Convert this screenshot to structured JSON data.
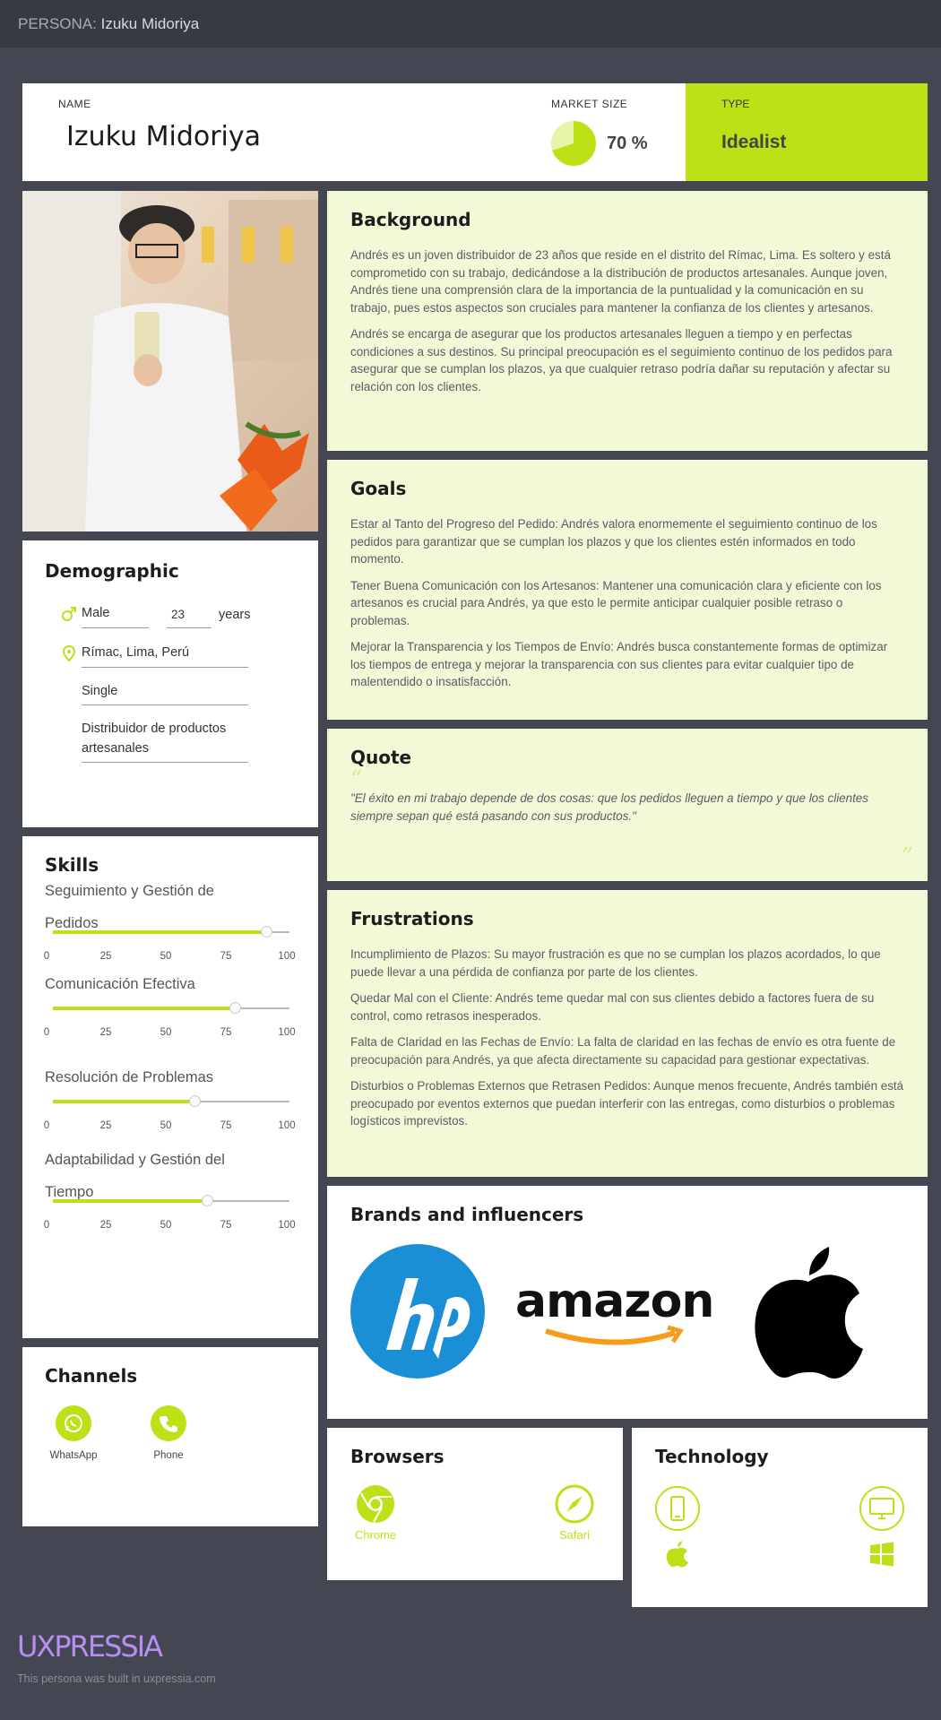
{
  "topbar": {
    "prefix": "PERSONA:",
    "name": "Izuku Midoriya"
  },
  "header": {
    "name_label": "NAME",
    "name": "Izuku Midoriya",
    "market_label": "MARKET SIZE",
    "market_value": "70 %",
    "market_fraction": 0.7,
    "type_label": "TYPE",
    "type_value": "Idealist"
  },
  "demographic": {
    "title": "Demographic",
    "gender": "Male",
    "age": "23",
    "age_unit": "years",
    "location": "Rímac, Lima, Perú",
    "status": "Single",
    "job_line1": "Distribuidor de productos",
    "job_line2": "artesanales"
  },
  "skills": {
    "title": "Skills",
    "ticks": [
      "0",
      "25",
      "50",
      "75",
      "100"
    ],
    "items": [
      {
        "line1": "Seguimiento y Gestión de",
        "line2": "Pedidos",
        "value": 90
      },
      {
        "line1": "Comunicación Efectiva",
        "line2": "",
        "value": 77
      },
      {
        "line1": "Resolución de Problemas",
        "line2": "",
        "value": 60
      },
      {
        "line1": "Adaptabilidad y Gestión del",
        "line2": "Tiempo",
        "value": 65
      }
    ]
  },
  "channels": {
    "title": "Channels",
    "items": [
      {
        "label": "WhatsApp",
        "icon": "whatsapp-icon"
      },
      {
        "label": "Phone",
        "icon": "phone-icon"
      }
    ]
  },
  "background": {
    "title": "Background",
    "p1": "Andrés es un joven distribuidor de 23 años que reside en el distrito del Rímac, Lima. Es soltero y está comprometido con su trabajo, dedicándose a la distribución de productos artesanales. Aunque joven, Andrés tiene una comprensión clara de la importancia de la puntualidad y la comunicación en su trabajo, pues estos aspectos son cruciales para mantener la confianza de los clientes y artesanos.",
    "p2": "Andrés se encarga de asegurar que los productos artesanales lleguen a tiempo y en perfectas condiciones a sus destinos. Su principal preocupación es el seguimiento continuo de los pedidos para asegurar que se cumplan los plazos, ya que cualquier retraso podría dañar su reputación y afectar su relación con los clientes."
  },
  "goals": {
    "title": "Goals",
    "p1": "Estar al Tanto del Progreso del Pedido: Andrés valora enormemente el seguimiento continuo de los pedidos para garantizar que se cumplan los plazos y que los clientes estén informados en todo momento.",
    "p2": "Tener Buena Comunicación con los Artesanos: Mantener una comunicación clara y eficiente con los artesanos es crucial para Andrés, ya que esto le permite anticipar cualquier posible retraso o problemas.",
    "p3": "Mejorar la Transparencia y los Tiempos de Envío: Andrés busca constantemente formas de optimizar los tiempos de entrega y mejorar la transparencia con sus clientes para evitar cualquier tipo de malentendido o insatisfacción."
  },
  "quote": {
    "title": "Quote",
    "text": "\"El éxito en mi trabajo depende de dos cosas: que los pedidos lleguen a tiempo y que los clientes siempre sepan qué está pasando con sus productos.\""
  },
  "frustrations": {
    "title": "Frustrations",
    "p1": "Incumplimiento de Plazos: Su mayor frustración es que no se cumplan los plazos acordados, lo que puede llevar a una pérdida de confianza por parte de los clientes.",
    "p2": "Quedar Mal con el Cliente: Andrés teme quedar mal con sus clientes debido a factores fuera de su control, como retrasos inesperados.",
    "p3": "Falta de Claridad en las Fechas de Envío: La falta de claridad en las fechas de envío es otra fuente de preocupación para Andrés, ya que afecta directamente su capacidad para gestionar expectativas.",
    "p4": "Disturbios o Problemas Externos que Retrasen Pedidos: Aunque menos frecuente, Andrés también está preocupado por eventos externos que puedan interferir con las entregas, como disturbios o problemas logísticos imprevistos."
  },
  "brands": {
    "title": "Brands and influencers",
    "items": [
      "hp-logo",
      "amazon-logo",
      "apple-logo"
    ],
    "amazon_text": "amazon"
  },
  "browsers": {
    "title": "Browsers",
    "items": [
      {
        "label": "Chrome"
      },
      {
        "label": "Safari"
      }
    ]
  },
  "technology": {
    "title": "Technology",
    "items": [
      "mobile-icon",
      "desktop-icon",
      "apple-icon",
      "windows-icon"
    ]
  },
  "footer": {
    "brand": "UXPRESSIA",
    "note": "This persona was built in uxpressia.com"
  },
  "colors": {
    "accent": "#bde117",
    "panel": "#f2f9d7",
    "background": "#444751",
    "footer_brand": "#b98ef2"
  }
}
